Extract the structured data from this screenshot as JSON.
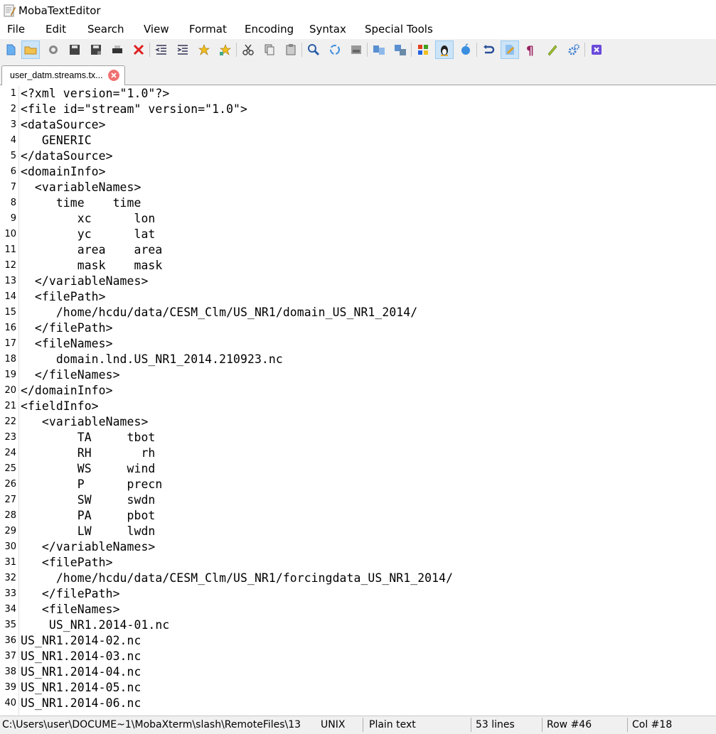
{
  "window": {
    "title": "MobaTextEditor"
  },
  "menu": [
    "File",
    "Edit",
    "Search",
    "View",
    "Format",
    "Encoding",
    "Syntax",
    "Special Tools"
  ],
  "toolbar": {
    "icons": [
      "new-file-icon",
      "open-folder-icon",
      "reload-icon",
      "save-icon",
      "save-as-icon",
      "print-icon",
      "close-file-icon",
      "indent-decrease-icon",
      "indent-increase-icon",
      "bookmark-icon",
      "bookmark-next-icon",
      "cut-icon",
      "copy-icon",
      "paste-icon",
      "find-icon",
      "replace-icon",
      "goto-icon",
      "compare-icon",
      "split-view-icon",
      "windows-eol-icon",
      "linux-eol-icon",
      "mac-eol-icon",
      "undo-icon",
      "highlight-icon",
      "show-formatting-icon",
      "edit-pencil-icon",
      "settings-icon",
      "exit-icon"
    ],
    "active": [
      "open-folder-icon",
      "linux-eol-icon",
      "highlight-icon"
    ]
  },
  "tab": {
    "label": "user_datm.streams.tx..."
  },
  "editor": {
    "lines": [
      "<?xml version=\"1.0\"?>",
      "<file id=\"stream\" version=\"1.0\">",
      "<dataSource>",
      "   GENERIC",
      "</dataSource>",
      "<domainInfo>",
      "  <variableNames>",
      "     time    time",
      "        xc      lon",
      "        yc      lat",
      "        area    area",
      "        mask    mask",
      "  </variableNames>",
      "  <filePath>",
      "     /home/hcdu/data/CESM_Clm/US_NR1/domain_US_NR1_2014/",
      "  </filePath>",
      "  <fileNames>",
      "     domain.lnd.US_NR1_2014.210923.nc",
      "  </fileNames>",
      "</domainInfo>",
      "<fieldInfo>",
      "   <variableNames>",
      "        TA     tbot",
      "        RH       rh",
      "        WS     wind",
      "        P      precn",
      "        SW     swdn",
      "        PA     pbot",
      "        LW     lwdn",
      "   </variableNames>",
      "   <filePath>",
      "     /home/hcdu/data/CESM_Clm/US_NR1/forcingdata_US_NR1_2014/",
      "   </filePath>",
      "   <fileNames>",
      "    US_NR1.2014-01.nc",
      "US_NR1.2014-02.nc",
      "US_NR1.2014-03.nc",
      "US_NR1.2014-04.nc",
      "US_NR1.2014-05.nc",
      "US_NR1.2014-06.nc"
    ]
  },
  "status": {
    "path": "C:\\Users\\user\\DOCUME~1\\MobaXterm\\slash\\RemoteFiles\\13",
    "eol": "UNIX",
    "syntax": "Plain text",
    "lines": "53 lines",
    "row": "Row #46",
    "col": "Col #18"
  }
}
